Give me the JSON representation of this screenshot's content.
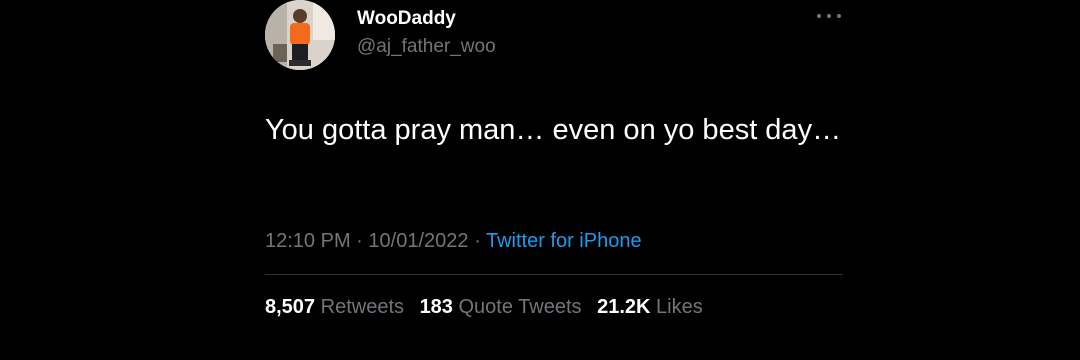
{
  "author": {
    "display_name": "WooDaddy",
    "handle": "@aj_father_woo",
    "avatar_icon": "profile-photo"
  },
  "more_icon": "ellipsis-icon",
  "tweet": {
    "text": "You gotta pray man… even on yo best day…",
    "time": "12:10 PM",
    "separator": "·",
    "date": "10/01/2022",
    "source": "Twitter for iPhone"
  },
  "stats": {
    "retweets_count": "8,507",
    "retweets_label": "Retweets",
    "quotes_count": "183",
    "quotes_label": "Quote Tweets",
    "likes_count": "21.2K",
    "likes_label": "Likes"
  },
  "colors": {
    "background": "#000000",
    "primary_text": "#ffffff",
    "secondary_text": "#71767b",
    "link": "#1d9bf0",
    "divider": "#2f3336"
  }
}
